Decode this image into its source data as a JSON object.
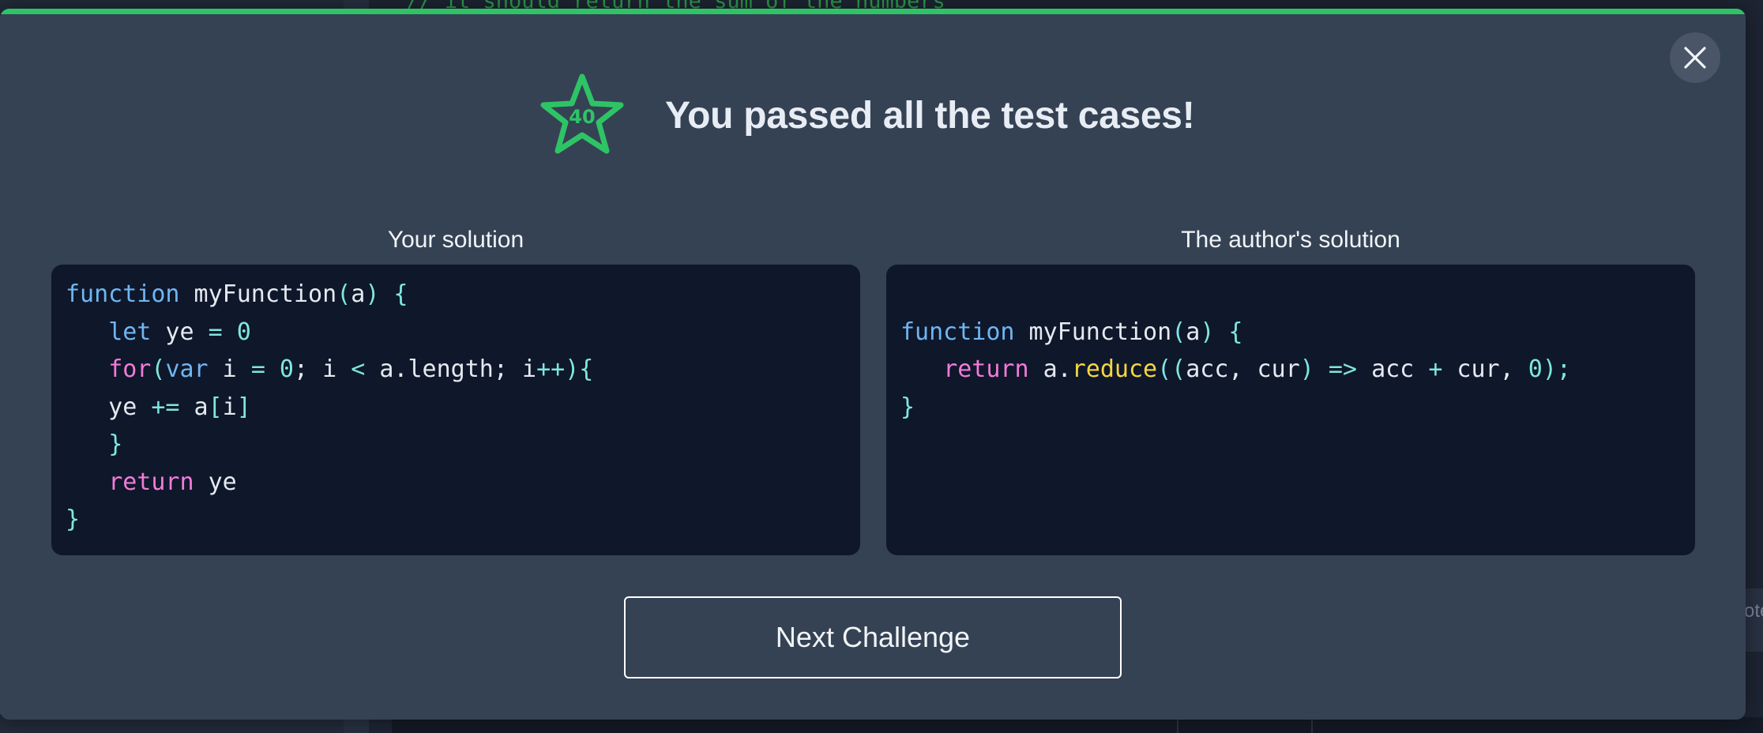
{
  "background": {
    "editor_comment": "// it should return the sum of the numbers",
    "right_panel_text": "ote"
  },
  "modal": {
    "accent_color": "#2ec466",
    "star_points": "40",
    "title": "You passed all the test cases!",
    "close_icon": "close-icon",
    "panels": [
      {
        "heading": "Your solution",
        "code": [
          [
            {
              "t": "function",
              "c": "kw-blue"
            },
            {
              "t": " myFunction",
              "c": "plain"
            },
            {
              "t": "(",
              "c": "punc"
            },
            {
              "t": "a",
              "c": "plain"
            },
            {
              "t": ")",
              "c": "punc"
            },
            {
              "t": " {",
              "c": "punc"
            }
          ],
          [
            {
              "t": "   ",
              "c": "plain"
            },
            {
              "t": "let",
              "c": "kw-blue"
            },
            {
              "t": " ye ",
              "c": "plain"
            },
            {
              "t": "=",
              "c": "punc"
            },
            {
              "t": " 0",
              "c": "num"
            }
          ],
          [
            {
              "t": "   ",
              "c": "plain"
            },
            {
              "t": "for",
              "c": "kw-pink"
            },
            {
              "t": "(",
              "c": "punc"
            },
            {
              "t": "var",
              "c": "kw-blue"
            },
            {
              "t": " i ",
              "c": "plain"
            },
            {
              "t": "=",
              "c": "punc"
            },
            {
              "t": " 0",
              "c": "num"
            },
            {
              "t": "; i ",
              "c": "plain"
            },
            {
              "t": "<",
              "c": "punc"
            },
            {
              "t": " a.length; i",
              "c": "plain"
            },
            {
              "t": "++",
              "c": "punc"
            },
            {
              "t": "){",
              "c": "punc"
            }
          ],
          [
            {
              "t": "   ye ",
              "c": "plain"
            },
            {
              "t": "+=",
              "c": "punc"
            },
            {
              "t": " a",
              "c": "plain"
            },
            {
              "t": "[",
              "c": "punc"
            },
            {
              "t": "i",
              "c": "plain"
            },
            {
              "t": "]",
              "c": "punc"
            }
          ],
          [
            {
              "t": "   ",
              "c": "plain"
            },
            {
              "t": "}",
              "c": "punc"
            }
          ],
          [
            {
              "t": "   ",
              "c": "plain"
            },
            {
              "t": "return",
              "c": "kw-pink"
            },
            {
              "t": " ye",
              "c": "plain"
            }
          ],
          [
            {
              "t": "}",
              "c": "punc"
            }
          ]
        ]
      },
      {
        "heading": "The author's solution",
        "code": [
          [
            {
              "t": "",
              "c": "plain"
            }
          ],
          [
            {
              "t": "function",
              "c": "kw-blue"
            },
            {
              "t": " myFunction",
              "c": "plain"
            },
            {
              "t": "(",
              "c": "punc"
            },
            {
              "t": "a",
              "c": "plain"
            },
            {
              "t": ")",
              "c": "punc"
            },
            {
              "t": " {",
              "c": "punc"
            }
          ],
          [
            {
              "t": "   ",
              "c": "plain"
            },
            {
              "t": "return",
              "c": "kw-pink"
            },
            {
              "t": " a.",
              "c": "plain"
            },
            {
              "t": "reduce",
              "c": "fn-yellow"
            },
            {
              "t": "((",
              "c": "punc"
            },
            {
              "t": "acc, cur",
              "c": "plain"
            },
            {
              "t": ")",
              "c": "punc"
            },
            {
              "t": " => ",
              "c": "punc"
            },
            {
              "t": "acc ",
              "c": "plain"
            },
            {
              "t": "+",
              "c": "punc"
            },
            {
              "t": " cur, ",
              "c": "plain"
            },
            {
              "t": "0",
              "c": "num"
            },
            {
              "t": ");",
              "c": "punc"
            }
          ],
          [
            {
              "t": "}",
              "c": "punc"
            }
          ]
        ]
      }
    ],
    "next_button_label": "Next Challenge"
  }
}
